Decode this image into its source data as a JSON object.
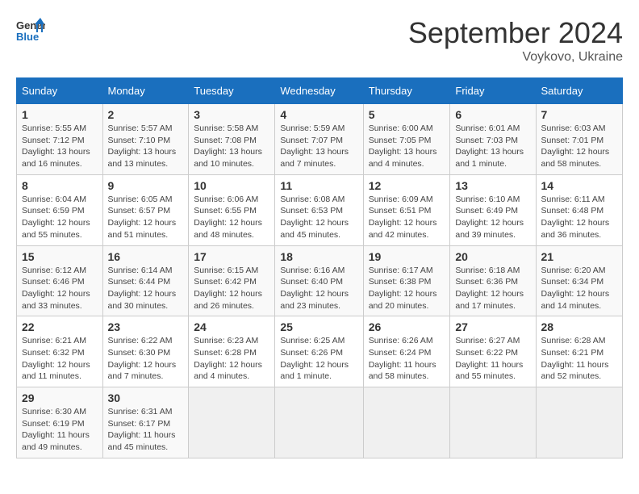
{
  "logo": {
    "line1": "General",
    "line2": "Blue"
  },
  "title": "September 2024",
  "subtitle": "Voykovo, Ukraine",
  "days_of_week": [
    "Sunday",
    "Monday",
    "Tuesday",
    "Wednesday",
    "Thursday",
    "Friday",
    "Saturday"
  ],
  "weeks": [
    [
      {
        "day": "1",
        "info": "Sunrise: 5:55 AM\nSunset: 7:12 PM\nDaylight: 13 hours\nand 16 minutes."
      },
      {
        "day": "2",
        "info": "Sunrise: 5:57 AM\nSunset: 7:10 PM\nDaylight: 13 hours\nand 13 minutes."
      },
      {
        "day": "3",
        "info": "Sunrise: 5:58 AM\nSunset: 7:08 PM\nDaylight: 13 hours\nand 10 minutes."
      },
      {
        "day": "4",
        "info": "Sunrise: 5:59 AM\nSunset: 7:07 PM\nDaylight: 13 hours\nand 7 minutes."
      },
      {
        "day": "5",
        "info": "Sunrise: 6:00 AM\nSunset: 7:05 PM\nDaylight: 13 hours\nand 4 minutes."
      },
      {
        "day": "6",
        "info": "Sunrise: 6:01 AM\nSunset: 7:03 PM\nDaylight: 13 hours\nand 1 minute."
      },
      {
        "day": "7",
        "info": "Sunrise: 6:03 AM\nSunset: 7:01 PM\nDaylight: 12 hours\nand 58 minutes."
      }
    ],
    [
      {
        "day": "8",
        "info": "Sunrise: 6:04 AM\nSunset: 6:59 PM\nDaylight: 12 hours\nand 55 minutes."
      },
      {
        "day": "9",
        "info": "Sunrise: 6:05 AM\nSunset: 6:57 PM\nDaylight: 12 hours\nand 51 minutes."
      },
      {
        "day": "10",
        "info": "Sunrise: 6:06 AM\nSunset: 6:55 PM\nDaylight: 12 hours\nand 48 minutes."
      },
      {
        "day": "11",
        "info": "Sunrise: 6:08 AM\nSunset: 6:53 PM\nDaylight: 12 hours\nand 45 minutes."
      },
      {
        "day": "12",
        "info": "Sunrise: 6:09 AM\nSunset: 6:51 PM\nDaylight: 12 hours\nand 42 minutes."
      },
      {
        "day": "13",
        "info": "Sunrise: 6:10 AM\nSunset: 6:49 PM\nDaylight: 12 hours\nand 39 minutes."
      },
      {
        "day": "14",
        "info": "Sunrise: 6:11 AM\nSunset: 6:48 PM\nDaylight: 12 hours\nand 36 minutes."
      }
    ],
    [
      {
        "day": "15",
        "info": "Sunrise: 6:12 AM\nSunset: 6:46 PM\nDaylight: 12 hours\nand 33 minutes."
      },
      {
        "day": "16",
        "info": "Sunrise: 6:14 AM\nSunset: 6:44 PM\nDaylight: 12 hours\nand 30 minutes."
      },
      {
        "day": "17",
        "info": "Sunrise: 6:15 AM\nSunset: 6:42 PM\nDaylight: 12 hours\nand 26 minutes."
      },
      {
        "day": "18",
        "info": "Sunrise: 6:16 AM\nSunset: 6:40 PM\nDaylight: 12 hours\nand 23 minutes."
      },
      {
        "day": "19",
        "info": "Sunrise: 6:17 AM\nSunset: 6:38 PM\nDaylight: 12 hours\nand 20 minutes."
      },
      {
        "day": "20",
        "info": "Sunrise: 6:18 AM\nSunset: 6:36 PM\nDaylight: 12 hours\nand 17 minutes."
      },
      {
        "day": "21",
        "info": "Sunrise: 6:20 AM\nSunset: 6:34 PM\nDaylight: 12 hours\nand 14 minutes."
      }
    ],
    [
      {
        "day": "22",
        "info": "Sunrise: 6:21 AM\nSunset: 6:32 PM\nDaylight: 12 hours\nand 11 minutes."
      },
      {
        "day": "23",
        "info": "Sunrise: 6:22 AM\nSunset: 6:30 PM\nDaylight: 12 hours\nand 7 minutes."
      },
      {
        "day": "24",
        "info": "Sunrise: 6:23 AM\nSunset: 6:28 PM\nDaylight: 12 hours\nand 4 minutes."
      },
      {
        "day": "25",
        "info": "Sunrise: 6:25 AM\nSunset: 6:26 PM\nDaylight: 12 hours\nand 1 minute."
      },
      {
        "day": "26",
        "info": "Sunrise: 6:26 AM\nSunset: 6:24 PM\nDaylight: 11 hours\nand 58 minutes."
      },
      {
        "day": "27",
        "info": "Sunrise: 6:27 AM\nSunset: 6:22 PM\nDaylight: 11 hours\nand 55 minutes."
      },
      {
        "day": "28",
        "info": "Sunrise: 6:28 AM\nSunset: 6:21 PM\nDaylight: 11 hours\nand 52 minutes."
      }
    ],
    [
      {
        "day": "29",
        "info": "Sunrise: 6:30 AM\nSunset: 6:19 PM\nDaylight: 11 hours\nand 49 minutes."
      },
      {
        "day": "30",
        "info": "Sunrise: 6:31 AM\nSunset: 6:17 PM\nDaylight: 11 hours\nand 45 minutes."
      },
      {
        "day": "",
        "info": ""
      },
      {
        "day": "",
        "info": ""
      },
      {
        "day": "",
        "info": ""
      },
      {
        "day": "",
        "info": ""
      },
      {
        "day": "",
        "info": ""
      }
    ]
  ]
}
